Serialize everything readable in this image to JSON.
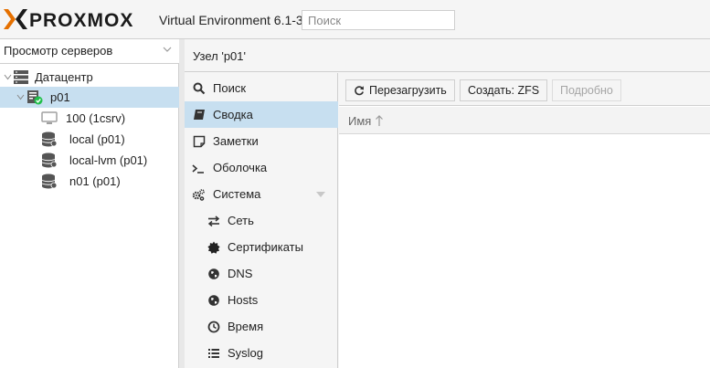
{
  "header": {
    "brand": "PROXMOX",
    "version": "Virtual Environment 6.1-3",
    "search_placeholder": "Поиск",
    "brand_colors": {
      "x_left": "#e57000",
      "x_right": "#1a1a1a",
      "text": "#1a1a1a"
    }
  },
  "tree": {
    "view_selector": "Просмотр серверов",
    "items": [
      {
        "label": "Датацентр",
        "icon": "datacenter-icon",
        "expanded": true
      },
      {
        "label": "p01",
        "icon": "server-online-icon",
        "expanded": true,
        "selected": true
      },
      {
        "label": "100 (1csrv)",
        "icon": "vm-icon"
      },
      {
        "label": "local (p01)",
        "icon": "storage-icon"
      },
      {
        "label": "local-lvm (p01)",
        "icon": "storage-icon"
      },
      {
        "label": "n01 (p01)",
        "icon": "storage-icon"
      }
    ]
  },
  "node": {
    "title": "Узел 'p01'"
  },
  "menu": {
    "items": [
      {
        "label": "Поиск",
        "icon": "search-icon"
      },
      {
        "label": "Сводка",
        "icon": "book-icon",
        "selected": true
      },
      {
        "label": "Заметки",
        "icon": "notes-icon"
      },
      {
        "label": "Оболочка",
        "icon": "terminal-icon"
      },
      {
        "label": "Система",
        "icon": "cogs-icon",
        "expanded": true
      },
      {
        "label": "Сеть",
        "icon": "exchange-icon",
        "sub": true
      },
      {
        "label": "Сертификаты",
        "icon": "certificate-icon",
        "sub": true
      },
      {
        "label": "DNS",
        "icon": "globe-icon",
        "sub": true
      },
      {
        "label": "Hosts",
        "icon": "globe-icon",
        "sub": true
      },
      {
        "label": "Время",
        "icon": "clock-icon",
        "sub": true
      },
      {
        "label": "Syslog",
        "icon": "list-icon",
        "sub": true
      }
    ]
  },
  "toolbar": {
    "reload": "Перезагрузить",
    "create": "Создать: ZFS",
    "details": "Подробно"
  },
  "grid": {
    "columns": [
      "Имя"
    ],
    "sort": "ascending"
  },
  "colors": {
    "selected": "#c7dff0",
    "accent": "#e57000",
    "online": "#21bf4b"
  }
}
